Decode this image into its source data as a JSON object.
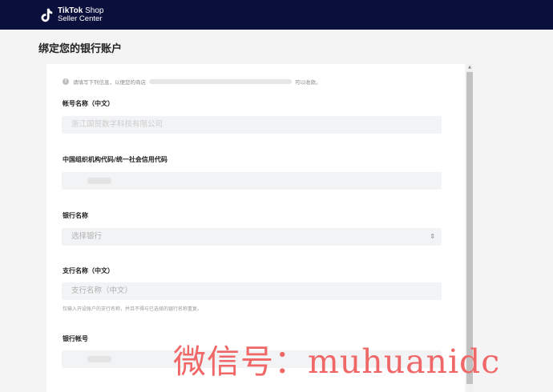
{
  "header": {
    "brand_line1_bold": "TikTok",
    "brand_line1_thin": " Shop",
    "brand_line2": "Seller Center",
    "background": "#0b0f3b",
    "logo_icon": "tiktok-note-icon"
  },
  "page": {
    "title": "绑定您的银行账户"
  },
  "form": {
    "info_before": "请填写下列信息，以便您的商店",
    "info_after": "可以收款。",
    "account_name_label": "帐号名称（中文）",
    "account_name_value": "浙江国贸数字科技有限公司",
    "org_code_label": "中国组织机构代码/统一社会信用代码",
    "bank_name_label": "银行名称",
    "bank_name_placeholder": "选择银行",
    "branch_label": "支行名称（中文）",
    "branch_placeholder": "支行名称（中文）",
    "branch_hint": "仅输入开设账户的支行名称，并且不得与已选择的银行名称重复。",
    "bank_account_label": "银行帐号"
  },
  "watermark": "微信号：muhuanidc"
}
